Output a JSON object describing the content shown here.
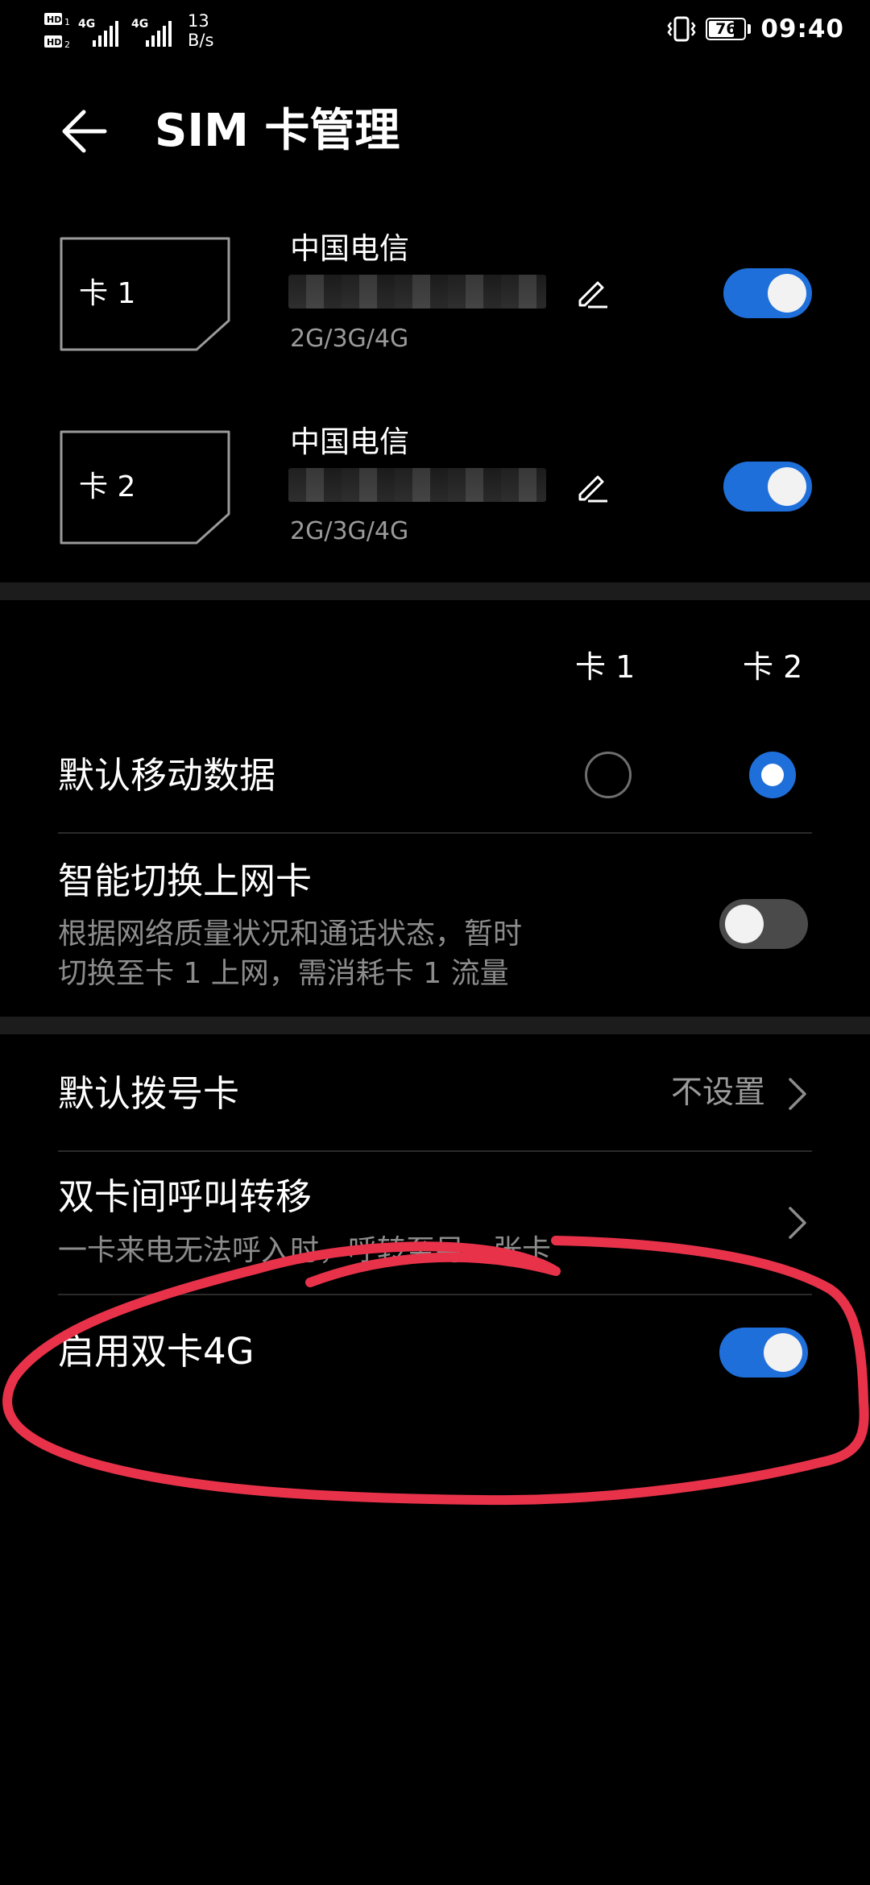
{
  "status_bar": {
    "sim1_hd": "HD",
    "sim2_hd": "HD",
    "sim1_net": "4G",
    "sim2_net": "4G",
    "speed_value": "13",
    "speed_unit": "B/s",
    "battery_level": 76,
    "battery_text": "76",
    "time": "09:40"
  },
  "header": {
    "title": "SIM 卡管理",
    "back_icon": "arrow-left-icon"
  },
  "sims": [
    {
      "label": "卡 1",
      "carrier": "中国电信",
      "network": "2G/3G/4G",
      "enabled": true
    },
    {
      "label": "卡 2",
      "carrier": "中国电信",
      "network": "2G/3G/4G",
      "enabled": true
    }
  ],
  "columns": {
    "card1": "卡 1",
    "card2": "卡 2"
  },
  "default_data": {
    "label": "默认移动数据",
    "selected": "card2"
  },
  "smart_switch": {
    "label": "智能切换上网卡",
    "desc_line1": "根据网络质量状况和通话状态，暂时",
    "desc_line2": "切换至卡 1 上网，需消耗卡 1 流量",
    "enabled": false
  },
  "default_dial": {
    "label": "默认拨号卡",
    "value": "不设置"
  },
  "call_forward": {
    "label": "双卡间呼叫转移",
    "desc": "一卡来电无法呼入时，呼转至另一张卡"
  },
  "dual_4g": {
    "label": "启用双卡4G",
    "enabled": true
  },
  "colors": {
    "accent": "#1f6fdb",
    "annotation": "#e8324a",
    "background": "#000000"
  }
}
